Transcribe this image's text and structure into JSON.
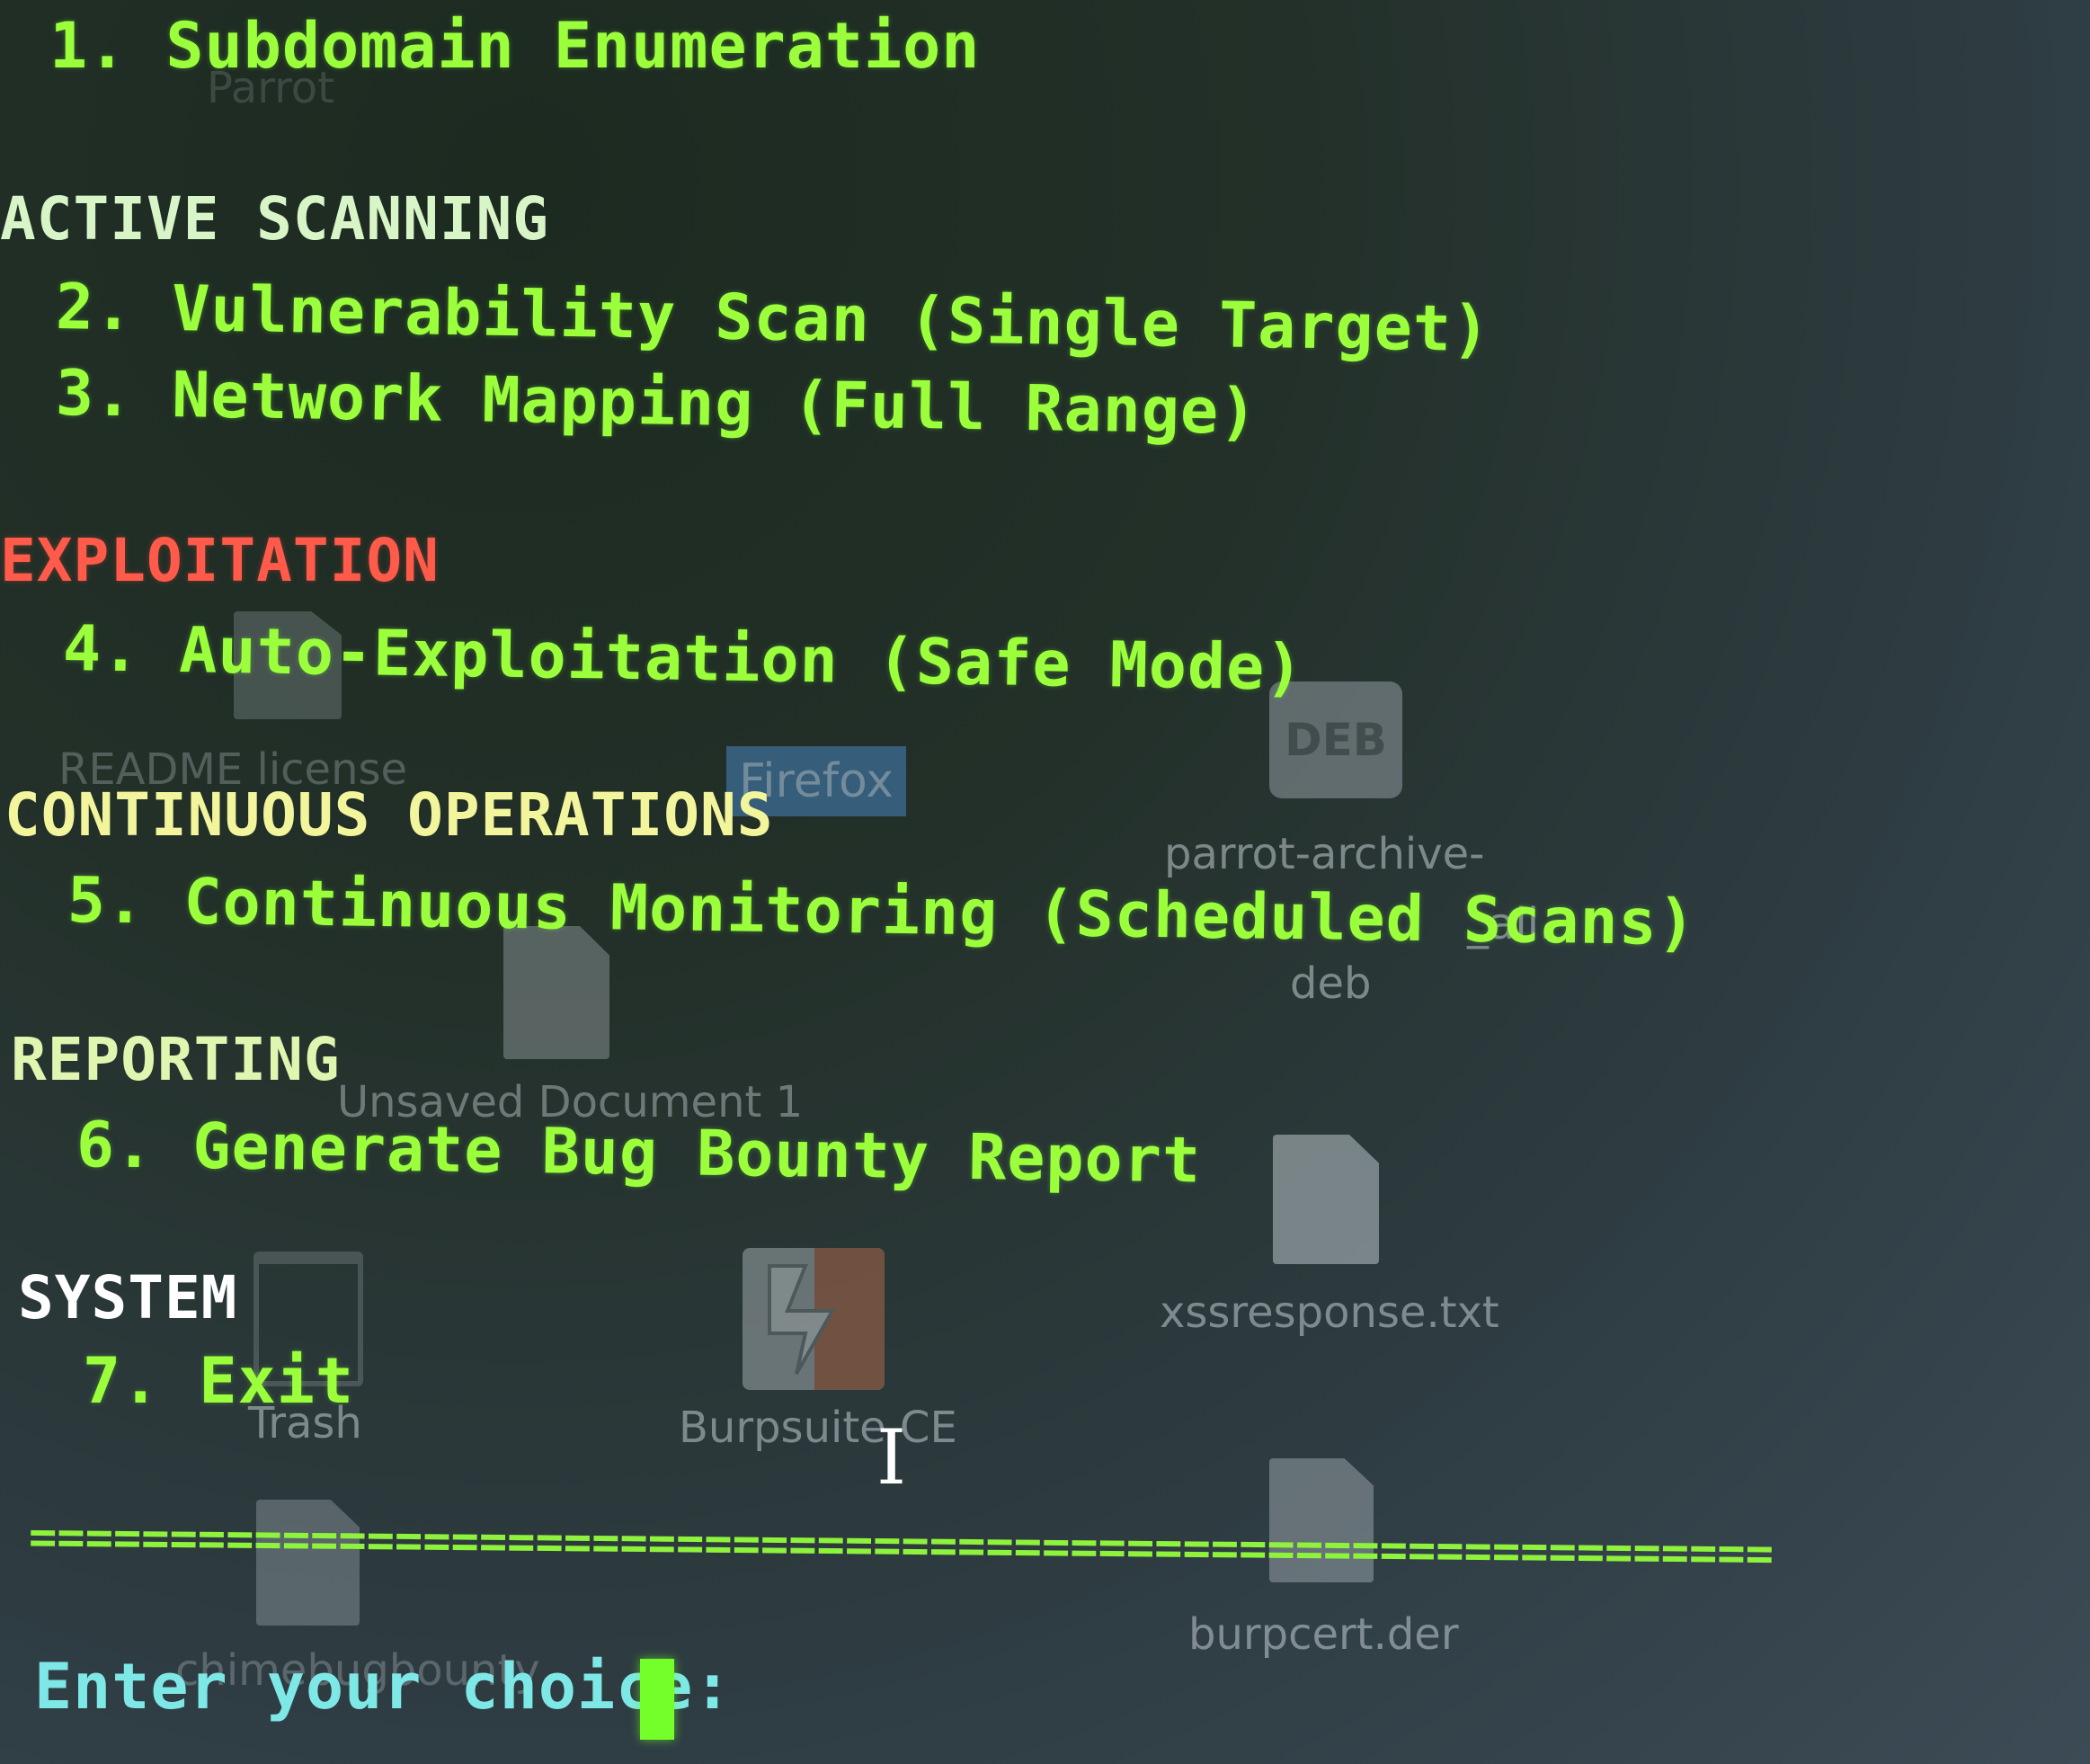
{
  "desktop": {
    "labels": {
      "parrot": "Parrot",
      "readme": "README license",
      "firefox": "Firefox",
      "deb_badge": "DEB",
      "deb_name_1": "parrot-archive-",
      "deb_name_2": "_all.",
      "deb_name_3": "deb",
      "unsaved": "Unsaved Document 1",
      "xss": "xssresponse.txt",
      "trash": "Trash",
      "burpsuite": "Burpsuite CE",
      "burpcert": "burpcert.der",
      "chime": "chimebugbounty"
    }
  },
  "terminal": {
    "item1": "1. Subdomain Enumeration",
    "section_active": "ACTIVE SCANNING",
    "item2": "2. Vulnerability Scan (Single Target)",
    "item3": "3. Network Mapping (Full Range)",
    "section_exploit": "EXPLOITATION",
    "item4": "4. Auto-Exploitation (Safe Mode)",
    "section_continuous": "CONTINUOUS OPERATIONS",
    "item5": "5. Continuous Monitoring (Scheduled Scans)",
    "section_reporting": "REPORTING",
    "item6": "6. Generate Bug Bounty Report",
    "section_system": "SYSTEM",
    "item7": "7. Exit",
    "separator": "==============================================================",
    "prompt": "Enter your choice: "
  },
  "colors": {
    "menu_item": "#9cff3c",
    "section_red": "#ff5a4a",
    "section_yellow": "#f2f59b",
    "prompt": "#7ee8e6",
    "cursor": "#74ff2a"
  }
}
